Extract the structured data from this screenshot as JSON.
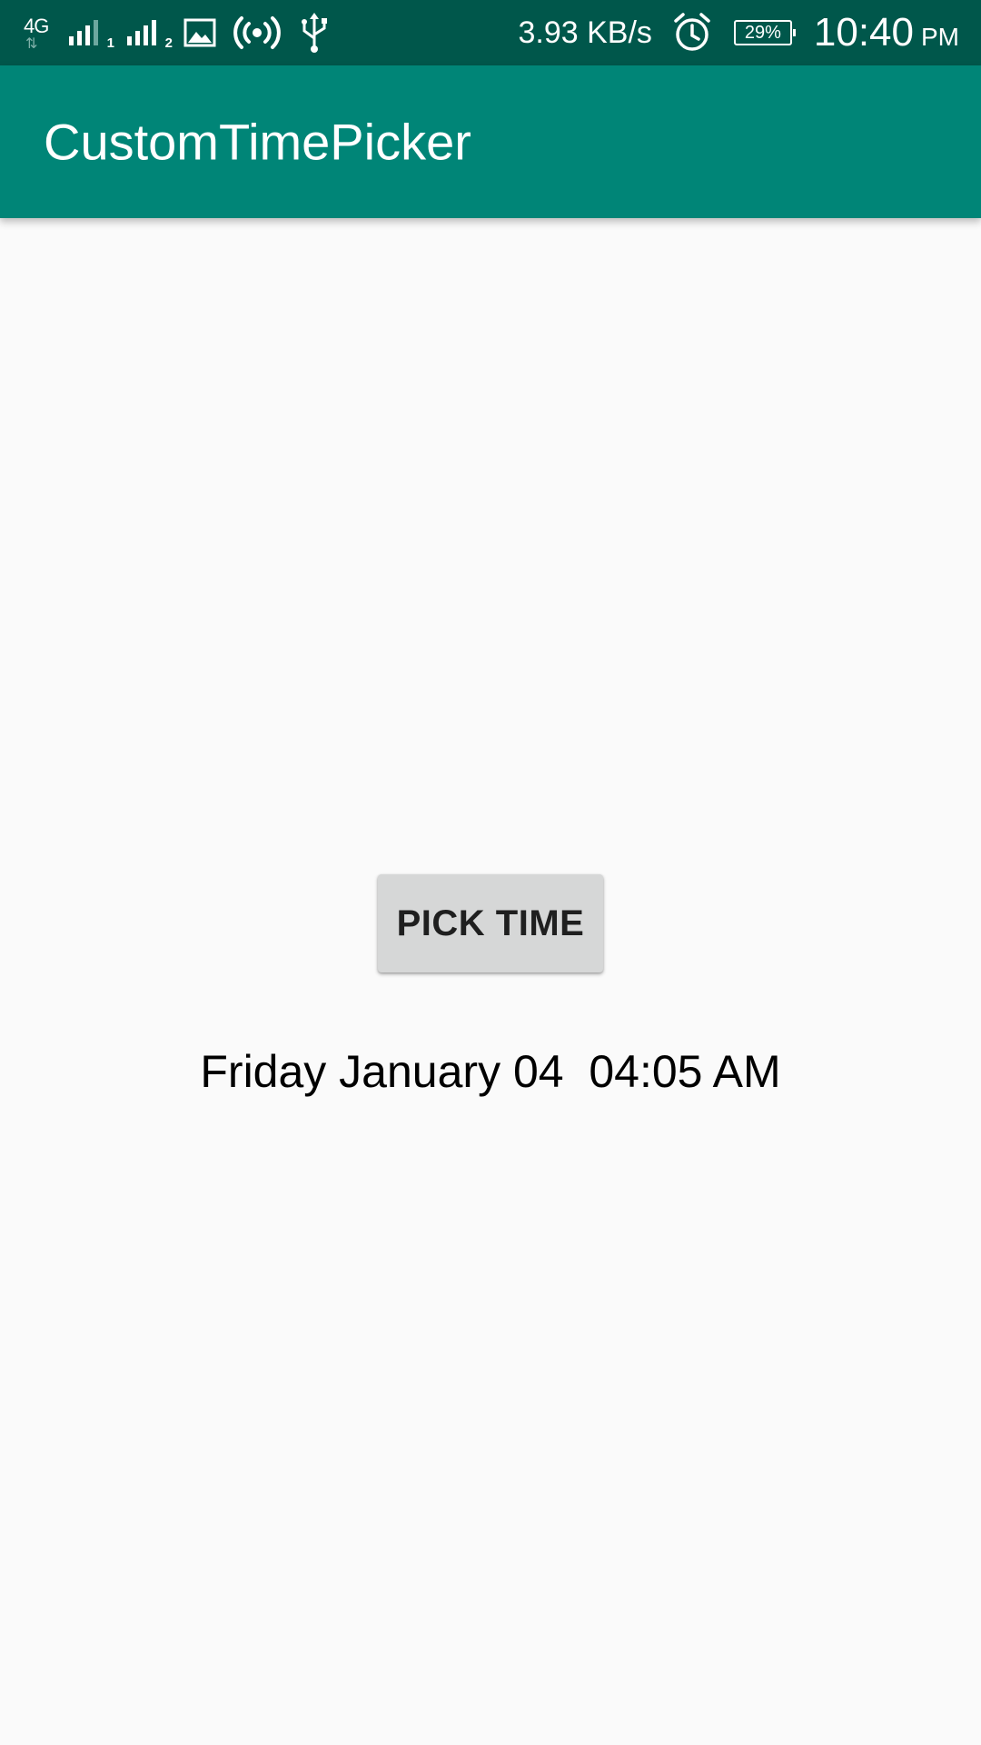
{
  "status_bar": {
    "network_type": "4G",
    "sim1_label": "1",
    "sim2_label": "2",
    "speed": "3.93 KB/s",
    "battery": "29%",
    "time": "10:40",
    "ampm": "PM",
    "icons": [
      "network-type-icon",
      "signal-sim1-icon",
      "signal-sim2-icon",
      "image-icon",
      "hotspot-icon",
      "usb-icon",
      "alarm-icon",
      "battery-icon"
    ]
  },
  "app_bar": {
    "title": "CustomTimePicker"
  },
  "main": {
    "pick_button_label": "PICK TIME",
    "selected_datetime": "Friday January 04  04:05 AM"
  },
  "colors": {
    "status_bar": "#00574b",
    "app_bar": "#008577",
    "background": "#fafafa",
    "button": "#d6d7d7"
  }
}
